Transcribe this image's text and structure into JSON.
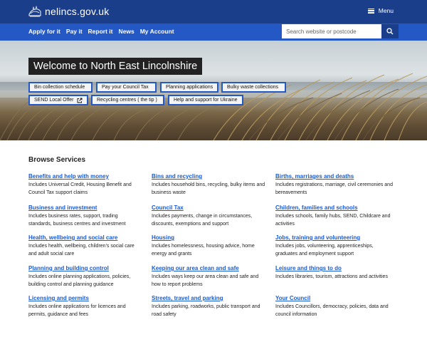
{
  "header": {
    "site_name": "nelincs.gov.uk",
    "menu_label": "Menu"
  },
  "nav": {
    "links": [
      "Apply for it",
      "Pay it",
      "Report it",
      "News",
      "My Account"
    ],
    "search_placeholder": "Search website or postcode"
  },
  "hero": {
    "title": "Welcome to North East Lincolnshire",
    "quick_links": [
      "Bin collection schedule",
      "Pay your Council Tax",
      "Planning applications",
      "Bulky waste collections",
      "SEND Local Offer",
      "Recycling centres ( the tip )",
      "Help and support for Ukraine"
    ]
  },
  "browse": {
    "title": "Browse Services",
    "services": [
      {
        "name": "Benefits and help with money",
        "desc": "Includes Universal Credit, Housing Benefit and Council Tax support claims"
      },
      {
        "name": "Bins and recycling",
        "desc": "Includes household bins, recycling, bulky items and business waste"
      },
      {
        "name": "Births, marriages and deaths",
        "desc": "Includes registrations, marriage, civil ceremonies and bereavements"
      },
      {
        "name": "Business and investment",
        "desc": "Includes business rates, support, trading standards, business centres and investment"
      },
      {
        "name": "Council Tax",
        "desc": "Includes payments, change in circumstances, discounts, exemptions and support"
      },
      {
        "name": "Children, families and schools",
        "desc": "Includes schools, family hubs, SEND, Childcare and activities"
      },
      {
        "name": "Health, wellbeing and social care",
        "desc": "Includes health, wellbeing, children's social care and adult social care"
      },
      {
        "name": "Housing",
        "desc": "Includes homelessness, housing advice, home energy and grants"
      },
      {
        "name": "Jobs, training and volunteering",
        "desc": "Includes jobs, volunteering, apprenticeships, graduates and employment support"
      },
      {
        "name": "Planning and building control",
        "desc": "Includes online planning applications, policies, building control and planning guidance"
      },
      {
        "name": "Keeping our area clean and safe",
        "desc": "Includes ways keep our area clean and safe and how to report problems"
      },
      {
        "name": "Leisure and things to do",
        "desc": "Includes libraries, tourism, attractions and activities"
      },
      {
        "name": "Licensing and permits",
        "desc": "Includes online applications for licences and permits, guidance and fees"
      },
      {
        "name": "Streets, travel and parking",
        "desc": "Includes parking, roadworks, public transport and road safety"
      },
      {
        "name": "Your Council",
        "desc": "Includes Councillors, democracy, policies, data and council information"
      }
    ]
  },
  "colors": {
    "header_bg": "#1b3e8a",
    "nav_bg": "#2458c5",
    "link": "#1a5bd0",
    "hero_title_bg": "#222222"
  }
}
